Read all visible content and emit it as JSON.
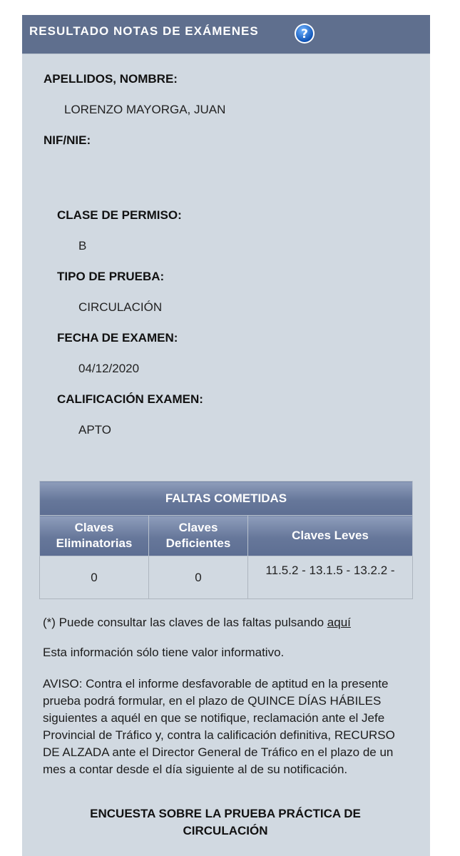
{
  "header": {
    "title": "RESULTADO NOTAS DE EXÁMENES",
    "help_icon": "help-icon"
  },
  "person": {
    "name_label": "APELLIDOS, NOMBRE:",
    "name_value": "LORENZO MAYORGA, JUAN",
    "nif_label": "NIF/NIE:",
    "nif_value": ""
  },
  "exam": {
    "permit_label": "CLASE DE PERMISO:",
    "permit_value": "B",
    "test_type_label": "TIPO DE PRUEBA:",
    "test_type_value": "CIRCULACIÓN",
    "date_label": "FECHA DE EXAMEN:",
    "date_value": "04/12/2020",
    "grade_label": "CALIFICACIÓN EXAMEN:",
    "grade_value": "APTO"
  },
  "faults": {
    "title": "FALTAS COMETIDAS",
    "col_elim_1": "Claves",
    "col_elim_2": "Eliminatorias",
    "col_def_1": "Claves",
    "col_def_2": "Deficientes",
    "col_leves": "Claves Leves",
    "elim_value": "0",
    "def_value": "0",
    "leves_value": "11.5.2 - 13.1.5 - 13.2.2 -"
  },
  "notes": {
    "consult_text": "(*) Puede consultar las claves de las faltas pulsando ",
    "consult_link": "aquí",
    "info": "Esta información sólo tiene valor informativo.",
    "aviso": "AVISO: Contra el informe desfavorable de aptitud en la presente prueba podrá formular, en el plazo de QUINCE DÍAS HÁBILES siguientes a aquél en que se notifique, reclamación ante el Jefe Provincial de Tráfico y, contra la calificación definitiva, RECURSO DE ALZADA ante el Director General de Tráfico en el plazo de un mes a contar desde el día siguiente al de su notificación."
  },
  "survey": {
    "title": "ENCUESTA SOBRE LA PRUEBA PRÁCTICA DE CIRCULACIÓN"
  },
  "colors": {
    "header_bg": "#5f6f8e",
    "panel_bg": "#d1d9e1",
    "table_header": "#66779a"
  }
}
